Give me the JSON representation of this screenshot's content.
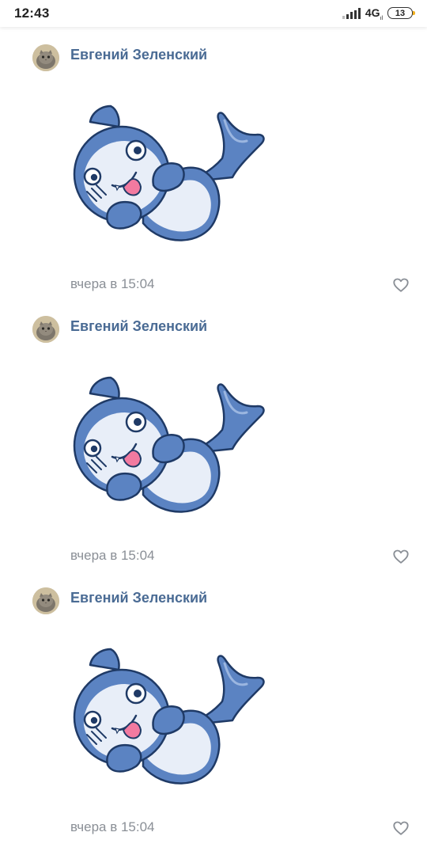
{
  "status_bar": {
    "time": "12:43",
    "network": "4G",
    "battery_level": "13",
    "battery_accent_color": "#f2b01e"
  },
  "messages": [
    {
      "author": "Евгений Зеленский",
      "timestamp": "вчера в 15:04",
      "sticker_icon": "shark-sticker",
      "liked": false
    },
    {
      "author": "Евгений Зеленский",
      "timestamp": "вчера в 15:04",
      "sticker_icon": "shark-sticker",
      "liked": false
    },
    {
      "author": "Евгений Зеленский",
      "timestamp": "вчера в 15:04",
      "sticker_icon": "shark-sticker",
      "liked": false
    }
  ],
  "colors": {
    "author_name": "#4a6b94",
    "timestamp": "#8a8f96",
    "shark_body": "#5b83c2",
    "shark_belly": "#e8eef8"
  }
}
